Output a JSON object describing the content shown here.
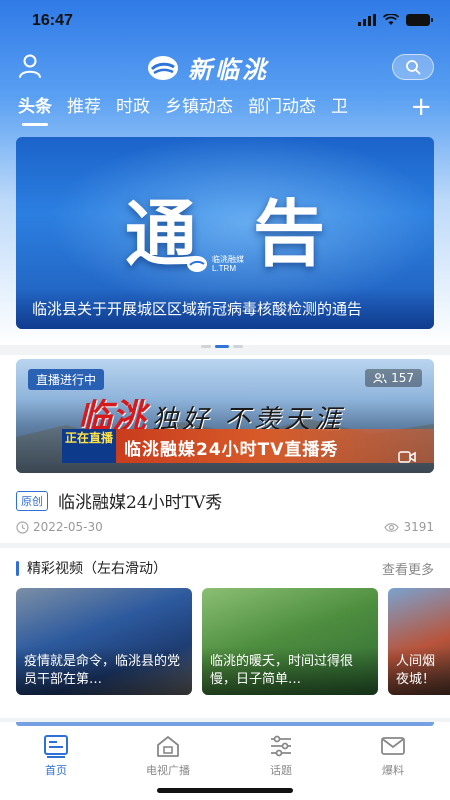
{
  "status": {
    "time": "16:47"
  },
  "brand": {
    "name": "新临洮"
  },
  "tabs": [
    "头条",
    "推荐",
    "时政",
    "乡镇动态",
    "部门动态",
    "卫"
  ],
  "banner": {
    "big_text": "通告",
    "logo_text_cn": "临洮融媒",
    "logo_text_en": "L.TRM",
    "caption": "临洮县关于开展城区区域新冠病毒核酸检测的通告"
  },
  "live": {
    "status_tag": "直播进行中",
    "viewers": "157",
    "art_red": "临洮",
    "art_dark": "独好  不羡天涯",
    "strip_badge": "正在直播",
    "strip_text": "临洮融媒24小时TV直播秀",
    "badge": "原创",
    "title": "临洮融媒24小时TV秀",
    "date": "2022-05-30",
    "views": "3191"
  },
  "videos": {
    "title": "精彩视频（左右滑动）",
    "more": "查看更多",
    "items": [
      {
        "caption": "疫情就是命令，临洮县的党员干部在第…"
      },
      {
        "caption": "临洮的暖夭，时间过得很慢，日子简单…"
      },
      {
        "caption": "人间烟夜城！"
      }
    ]
  },
  "tabbar": [
    "首页",
    "电视广播",
    "话题",
    "爆料"
  ],
  "colors": {
    "accent": "#2f6fd6",
    "live_red": "#d8191c"
  }
}
